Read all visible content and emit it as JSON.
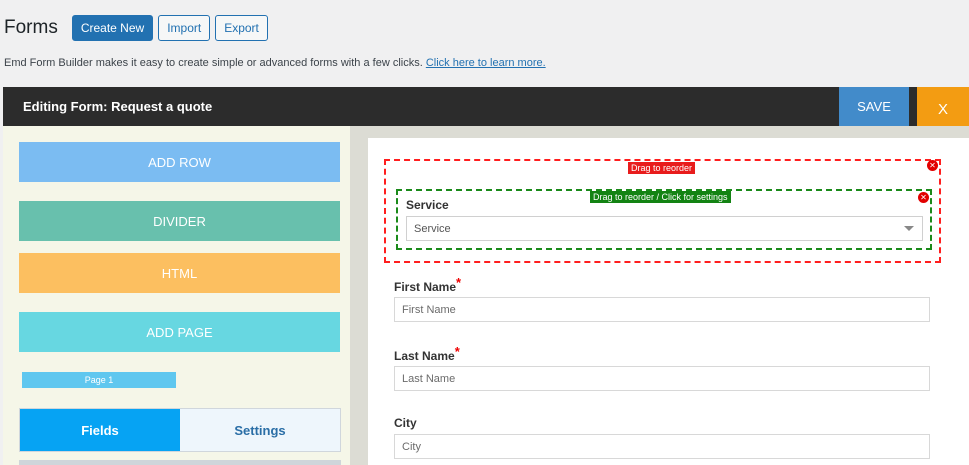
{
  "header": {
    "page_title": "Forms",
    "create_new": "Create New",
    "import": "Import",
    "export": "Export"
  },
  "intro": {
    "text": "Emd Form Builder makes it easy to create simple or advanced forms with a few clicks.",
    "link": "Click here to learn more."
  },
  "editor": {
    "title": "Editing Form: Request a quote",
    "save": "SAVE",
    "close": "X"
  },
  "toolbox": {
    "add_row": "ADD ROW",
    "divider": "DIVIDER",
    "html": "HTML",
    "add_page": "ADD PAGE",
    "page_tab": "Page 1",
    "tabs": [
      "Fields",
      "Settings"
    ],
    "active_tab": "Fields"
  },
  "canvas": {
    "row_badge": "Drag to reorder",
    "field_badge": "Drag to reorder / Click for settings",
    "remove_icon": "x-circle-icon",
    "fields": [
      {
        "label": "Service",
        "type": "select",
        "value": "Service",
        "required": false
      },
      {
        "label": "First Name",
        "type": "text",
        "placeholder": "First Name",
        "required": true
      },
      {
        "label": "Last Name",
        "type": "text",
        "placeholder": "Last Name",
        "required": true
      },
      {
        "label": "City",
        "type": "text",
        "placeholder": "City",
        "required": false
      }
    ],
    "required_mark": "*"
  },
  "colors": {
    "primary": "#2271b1",
    "save": "#428bca",
    "close": "#f39c12",
    "add_row": "#7bbcf2",
    "divider": "#68c0ad",
    "html": "#fcbf60",
    "add_page": "#67d7e1",
    "tab_active": "#06a3f3",
    "row_border": "#ff1e1e",
    "field_border": "#1a8a1a"
  }
}
